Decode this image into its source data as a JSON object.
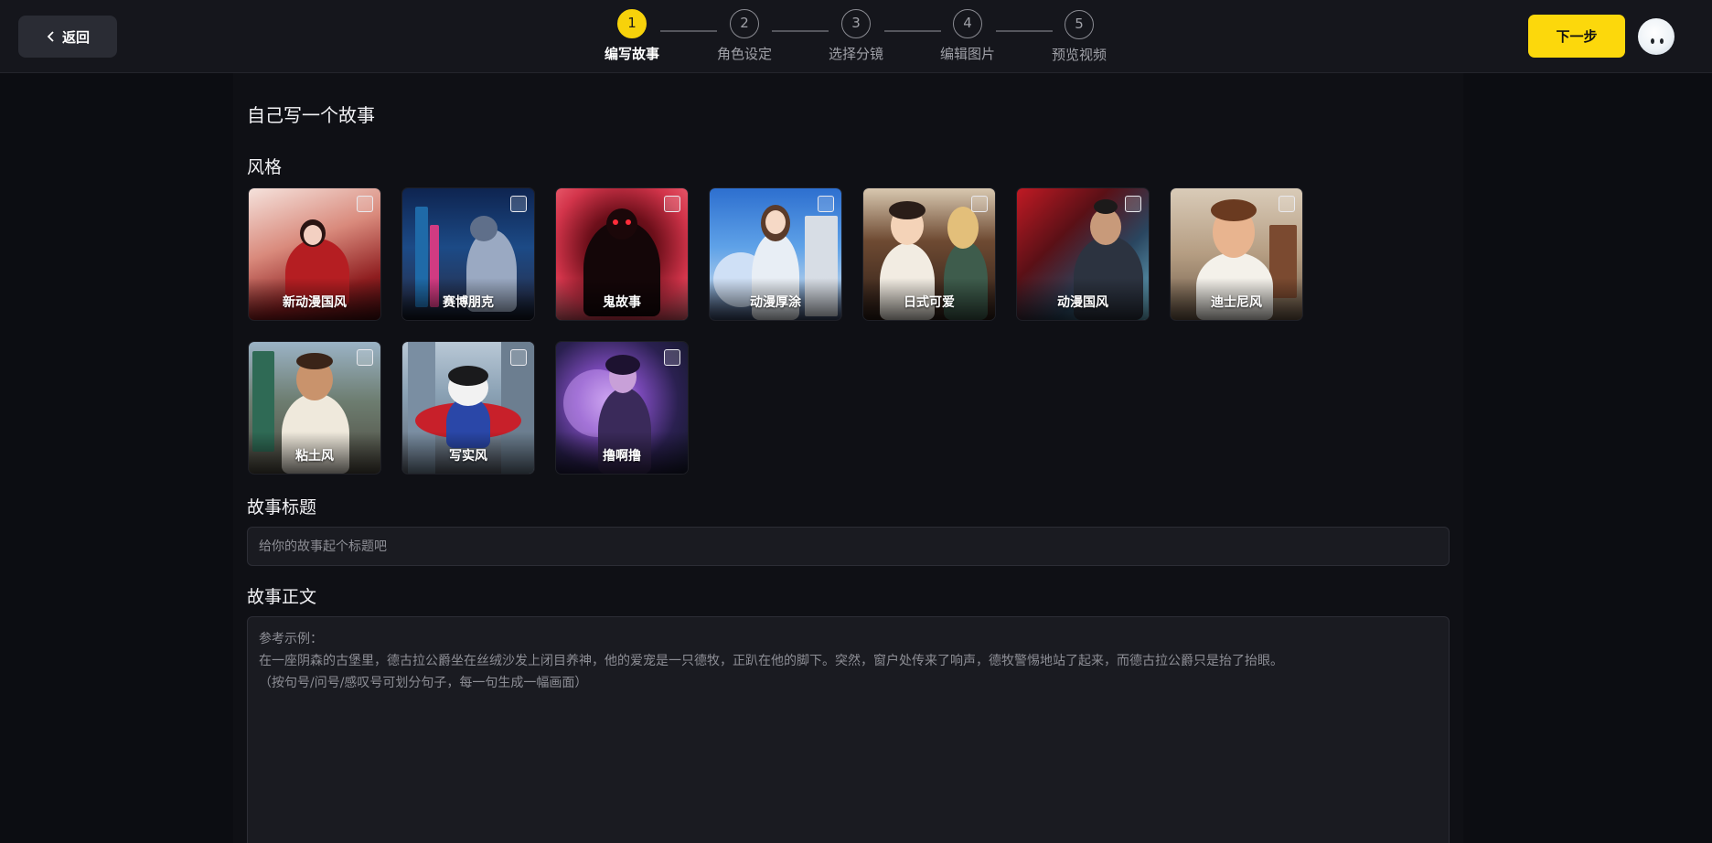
{
  "header": {
    "back_label": "返回",
    "next_label": "下一步",
    "steps": [
      {
        "number": "1",
        "label": "编写故事",
        "active": true
      },
      {
        "number": "2",
        "label": "角色设定",
        "active": false
      },
      {
        "number": "3",
        "label": "选择分镜",
        "active": false
      },
      {
        "number": "4",
        "label": "编辑图片",
        "active": false
      },
      {
        "number": "5",
        "label": "预览视频",
        "active": false
      }
    ]
  },
  "main": {
    "page_title": "自己写一个故事",
    "style_section_title": "风格",
    "styles": [
      {
        "label": "新动漫国风",
        "selected": false
      },
      {
        "label": "赛博朋克",
        "selected": false
      },
      {
        "label": "鬼故事",
        "selected": false
      },
      {
        "label": "动漫厚涂",
        "selected": false
      },
      {
        "label": "日式可爱",
        "selected": false
      },
      {
        "label": "动漫国风",
        "selected": false
      },
      {
        "label": "迪士尼风",
        "selected": false
      },
      {
        "label": "粘土风",
        "selected": false
      },
      {
        "label": "写实风",
        "selected": false
      },
      {
        "label": "撸啊撸",
        "selected": false
      }
    ],
    "title_section_title": "故事标题",
    "title_input": {
      "value": "",
      "placeholder": "给你的故事起个标题吧"
    },
    "body_section_title": "故事正文",
    "body_placeholder": {
      "line1": "参考示例：",
      "line2": "在一座阴森的古堡里，德古拉公爵坐在丝绒沙发上闭目养神，他的爱宠是一只德牧，正趴在他的脚下。突然，窗户处传来了响声，德牧警惕地站了起来，而德古拉公爵只是抬了抬眼。",
      "line3": "（按句号/问号/感叹号可划分句子，每一句生成一幅画面）"
    }
  },
  "colors": {
    "accent": "#fcd80c",
    "background": "#0c0d12",
    "topbar": "#15161c"
  }
}
